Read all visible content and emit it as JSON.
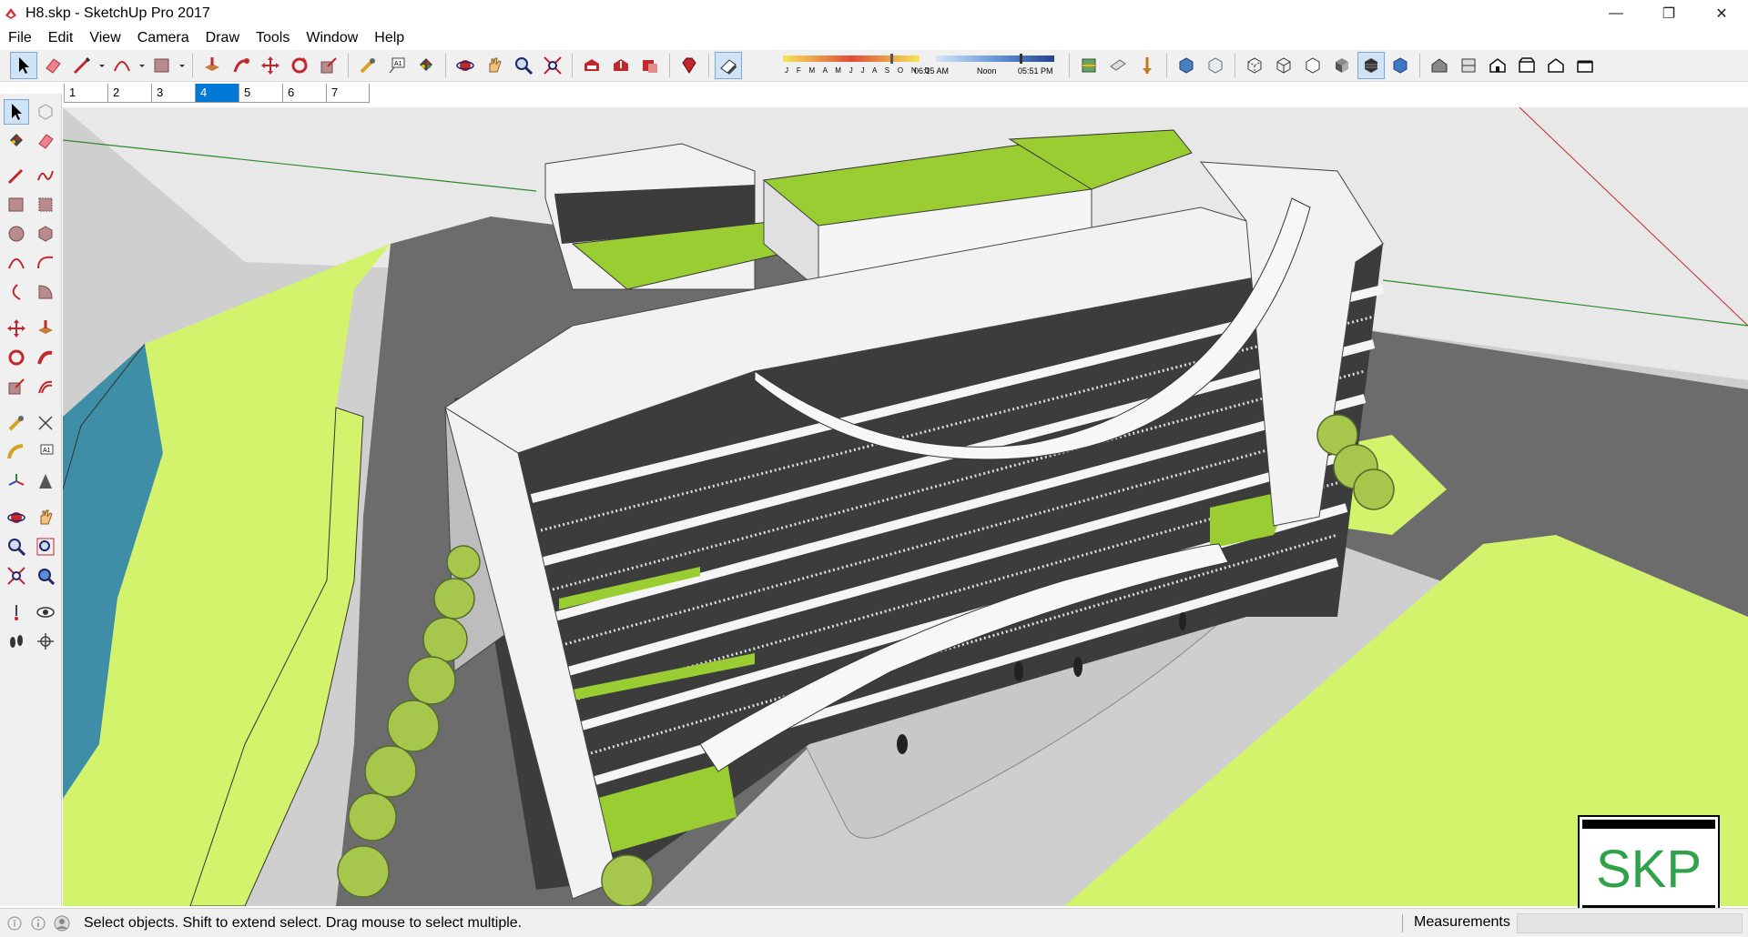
{
  "window": {
    "title": "H8.skp - SketchUp Pro 2017",
    "minimize": "—",
    "restore": "❐",
    "close": "✕"
  },
  "menu": [
    "File",
    "Edit",
    "View",
    "Camera",
    "Draw",
    "Tools",
    "Window",
    "Help"
  ],
  "shadow_settings": {
    "months": "J F M A M J J A S O N D",
    "time_start": "06:15 AM",
    "time_mid": "Noon",
    "time_end": "05:51 PM"
  },
  "scene_tabs": [
    "1",
    "2",
    "3",
    "4",
    "5",
    "6",
    "7"
  ],
  "active_scene_tab": "4",
  "status": {
    "hint": "Select objects. Shift to extend select. Drag mouse to select multiple.",
    "measurements_label": "Measurements",
    "measurements_value": ""
  },
  "badge": {
    "text": "SKP"
  },
  "colors": {
    "grass": "#d4f36c",
    "roof_green": "#9acd32",
    "road": "#6e6e6e",
    "water": "#3d8ea6",
    "facade_dark": "#3c3c3c",
    "building_white": "#f2f2f2",
    "tree": "#a6c74c",
    "badge_green": "#2fa24a"
  },
  "icons": {
    "toolbar": [
      "select-icon",
      "eraser-icon",
      "line-icon",
      "arc-icon",
      "shape-icon",
      "push-pull-icon",
      "follow-me-icon",
      "move-icon",
      "rotate-icon",
      "scale-icon",
      "tape-measure-icon",
      "text-icon",
      "paint-bucket-icon",
      "orbit-icon",
      "pan-icon",
      "zoom-icon",
      "zoom-extents-icon",
      "warehouse-icon",
      "share-model-icon",
      "extension-warehouse-icon",
      "ruby-icon",
      "shadows-toggle-icon",
      "section-plane-icon",
      "section-fill-icon",
      "display-section-icon",
      "xray-icon",
      "back-edges-icon",
      "wireframe-icon",
      "hidden-line-icon",
      "shaded-icon",
      "shaded-textures-icon",
      "monochrome-icon",
      "iso-view-icon",
      "top-view-icon",
      "front-view-icon",
      "right-view-icon",
      "back-view-icon",
      "left-view-icon"
    ]
  }
}
